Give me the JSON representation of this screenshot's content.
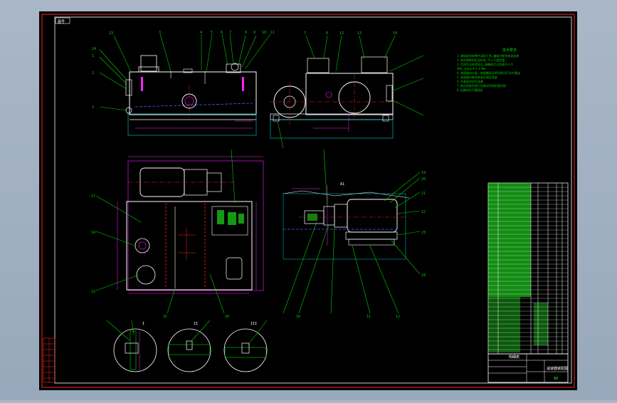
{
  "colors": {
    "background": "#000000",
    "frame": "#ff2020",
    "border": "#ffffff",
    "leader": "#00d000",
    "outline": "#ffffff",
    "centerline": "#ff2020",
    "dimension": "#ff20ff",
    "hidden": "#4060ff",
    "fill_green": "#20ff20",
    "viewport_bg": "#a9b7c8"
  },
  "drawing": {
    "title_block_label": "图号",
    "view_label_a": "A1",
    "section_label_1": "I",
    "section_label_2": "II",
    "section_label_3": "III",
    "tech_requirements_title": "技术要求",
    "tech_requirements_lines": [
      "1.装配前所有零件清洗干净,箱体内壁涂耐油油漆",
      "2.啮合侧隙用铅丝检验,不小于规定值",
      "3.用涂色法检验斑点,接触斑点沿齿高不小于",
      "  40%,沿齿长不小于50%",
      "4.减速器剖分面、各接触面及密封处均不允许漏油",
      "5.减速器内装润滑油至规定高度",
      "6.外表面涂灰色油漆",
      "7.按试验规范进行空载试验和负载试验",
      "8.运输时应可靠固定"
    ],
    "callouts_top_left": [
      "23",
      "3",
      "4",
      "5",
      "6",
      "7",
      "8",
      "9",
      "10",
      "11"
    ],
    "callouts_left_side": [
      "24",
      "1",
      "2",
      "3"
    ],
    "callouts_top_right": [
      "7",
      "8",
      "12",
      "13",
      "14"
    ],
    "callouts_plan_left": [
      "17",
      "14",
      "13"
    ],
    "callouts_plan_bottom": [
      "15",
      "16"
    ],
    "callouts_side_right": [
      "19",
      "20",
      "21",
      "22",
      "23",
      "24"
    ],
    "callouts_side_bottom": [
      "10",
      "11",
      "12"
    ],
    "parts_table_title": "明细表",
    "title_block_name": "减速器装配图",
    "drawing_number": "A0"
  }
}
